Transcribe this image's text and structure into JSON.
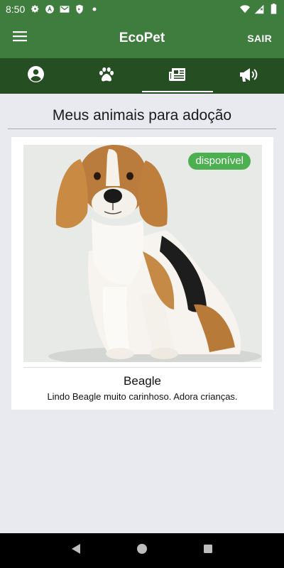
{
  "status_bar": {
    "time": "8:50",
    "icons_left": [
      "settings-icon",
      "vpn-icon",
      "gmail-icon",
      "shield-icon",
      "dot-icon"
    ],
    "icons_right": [
      "wifi-icon",
      "signal-icon",
      "battery-icon"
    ]
  },
  "app_bar": {
    "title": "EcoPet",
    "menu_icon": "menu-icon",
    "logout_label": "SAIR"
  },
  "tabs": [
    {
      "icon": "account-icon",
      "active": false
    },
    {
      "icon": "paw-icon",
      "active": false
    },
    {
      "icon": "newspaper-icon",
      "active": true
    },
    {
      "icon": "megaphone-icon",
      "active": false
    }
  ],
  "page": {
    "heading": "Meus animais para adoção"
  },
  "pets": [
    {
      "name": "Beagle",
      "description": "Lindo Beagle muito carinhoso. Adora crianças.",
      "status": "disponível"
    }
  ],
  "colors": {
    "primary": "#3f7d3f",
    "tab_bar": "#254f23",
    "badge": "#4caf50",
    "background": "#e9eaef"
  },
  "nav": [
    "back-icon",
    "home-icon",
    "recents-icon"
  ]
}
